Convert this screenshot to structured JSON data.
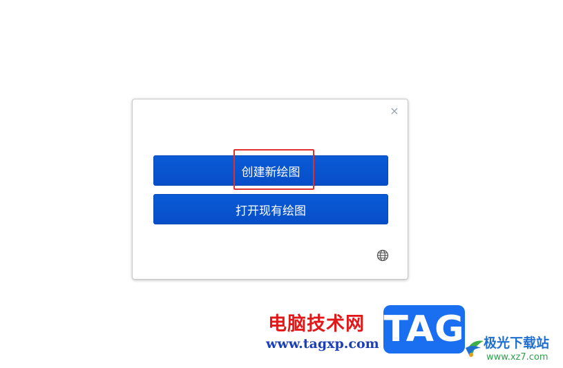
{
  "dialog": {
    "close_glyph": "×",
    "close_icon": "close-icon",
    "create_button_label": "创建新绘图",
    "open_button_label": "打开现有绘图",
    "language_icon": "globe-icon",
    "accent_color": "#0755cf",
    "highlight_color": "#e0302d"
  },
  "watermark": {
    "site_name": "电脑技术网",
    "site_url": "www.tagxp.com",
    "tag_logo_text": "TAG",
    "download_site_name": "极光下载站",
    "download_site_url": "www.xz7.com"
  }
}
